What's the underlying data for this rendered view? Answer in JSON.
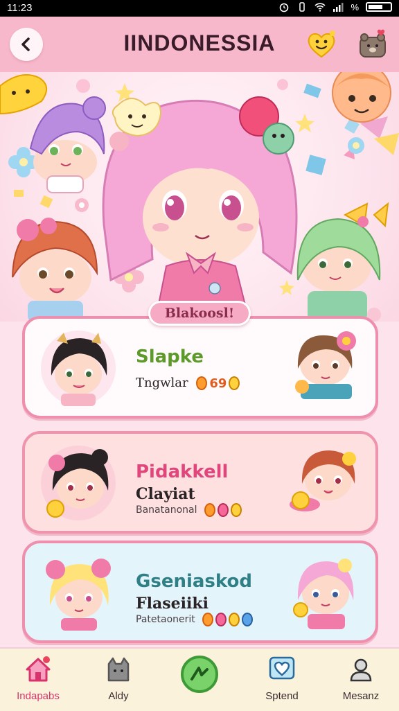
{
  "statusbar": {
    "time": "11:23",
    "battery": "%"
  },
  "header": {
    "title": "IINDONESSIA"
  },
  "hero": {
    "banner": "Blakoosl!"
  },
  "cards": [
    {
      "title": "Slapke",
      "subtitle": "Tngwlar",
      "badge": "69",
      "title_color": "#5d9a2a"
    },
    {
      "title": "Pidakkell",
      "subtitle": "Clayiat",
      "detail": "Banatanonal",
      "title_color": "#e0457c"
    },
    {
      "title": "Gseniaskod",
      "subtitle": "Flaseiiki",
      "detail": "Patetaonerit",
      "title_color": "#2f7f86"
    }
  ],
  "nav": {
    "items": [
      {
        "label": "Indapabs",
        "icon": "home-icon"
      },
      {
        "label": "Aldy",
        "icon": "cat-icon"
      },
      {
        "label": "",
        "icon": "compass-icon"
      },
      {
        "label": "Sptend",
        "icon": "heart-icon"
      },
      {
        "label": "Mesanz",
        "icon": "profile-icon"
      }
    ]
  },
  "colors": {
    "header": "#f7b8cb",
    "accent": "#e0457c",
    "nav_bg": "#fbf2dc"
  }
}
